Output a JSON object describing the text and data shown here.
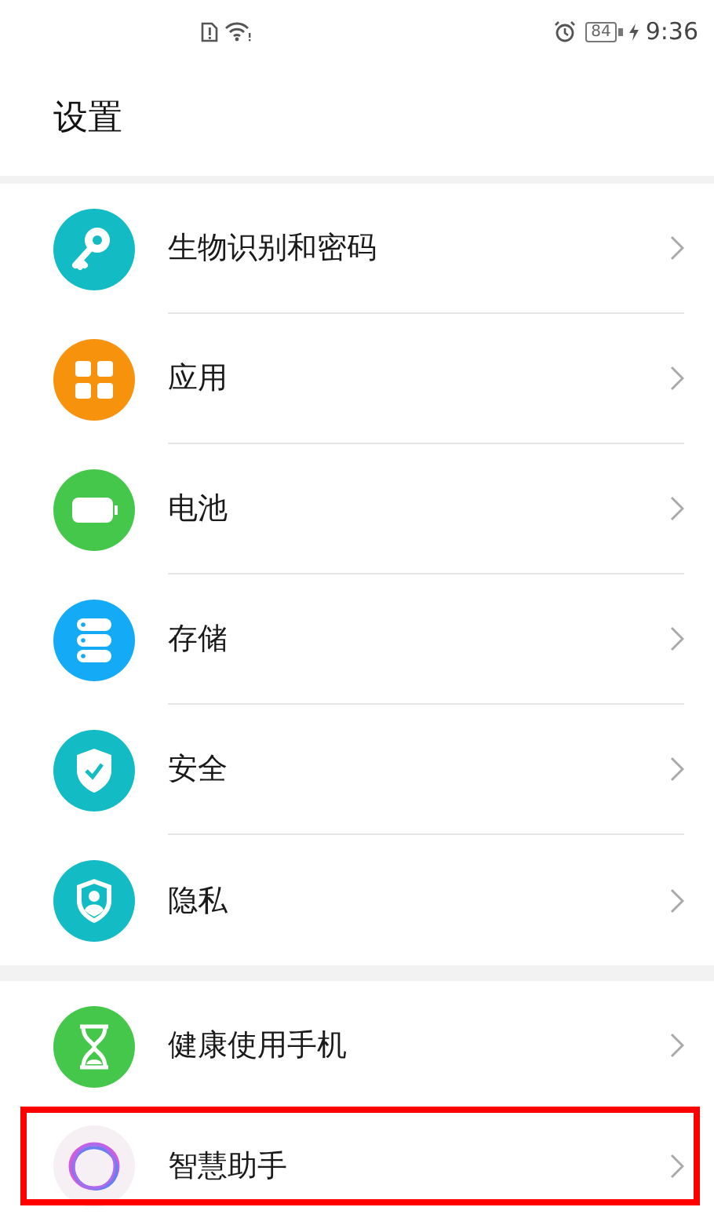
{
  "status_bar": {
    "battery": "84",
    "time": "9:36"
  },
  "title": "设置",
  "groups": [
    {
      "items": [
        {
          "kind": "key",
          "label": "生物识别和密码",
          "highlighted": false
        },
        {
          "kind": "apps",
          "label": "应用",
          "highlighted": false
        },
        {
          "kind": "battery",
          "label": "电池",
          "highlighted": false
        },
        {
          "kind": "storage",
          "label": "存储",
          "highlighted": false
        },
        {
          "kind": "security",
          "label": "安全",
          "highlighted": false
        },
        {
          "kind": "privacy",
          "label": "隐私",
          "highlighted": false
        }
      ]
    },
    {
      "items": [
        {
          "kind": "hourglass",
          "label": "健康使用手机",
          "highlighted": false
        },
        {
          "kind": "assistant",
          "label": "智慧助手",
          "highlighted": true
        }
      ]
    }
  ]
}
